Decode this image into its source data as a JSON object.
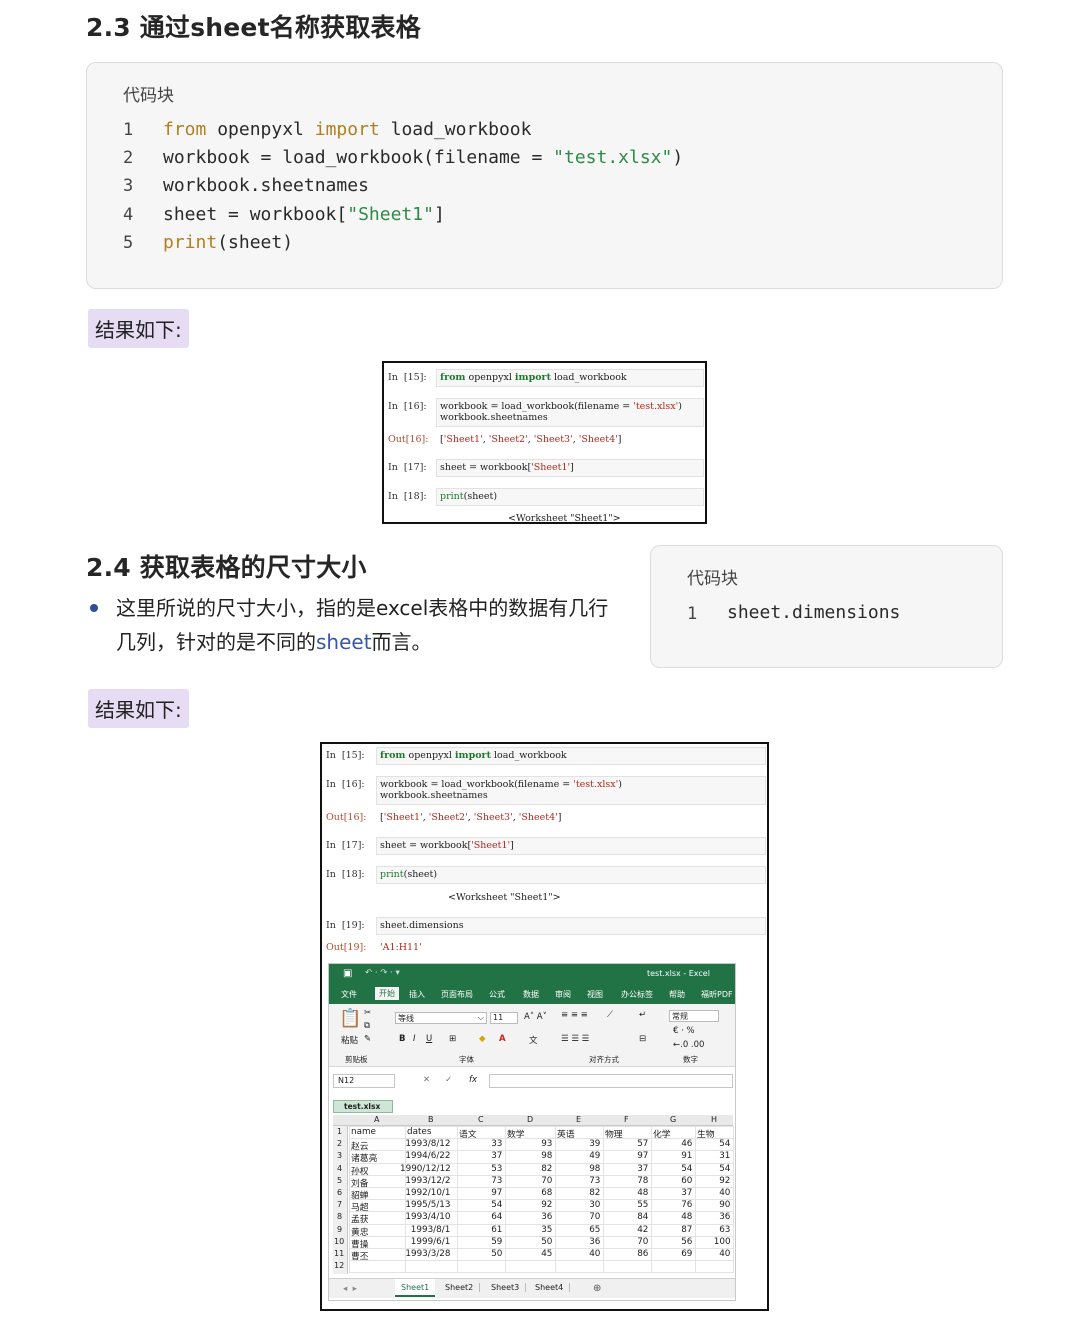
{
  "section1": {
    "title": "2.3 通过sheet名称获取表格",
    "code_caption": "代码块",
    "code_lines": [
      {
        "n": "1",
        "parts": [
          {
            "t": "from",
            "c": "kw"
          },
          {
            "t": " openpyxl ",
            "c": ""
          },
          {
            "t": "import",
            "c": "kw"
          },
          {
            "t": " load_workbook",
            "c": ""
          }
        ]
      },
      {
        "n": "2",
        "parts": [
          {
            "t": "workbook = load_workbook(filename = ",
            "c": ""
          },
          {
            "t": "\"test.xlsx\"",
            "c": "st"
          },
          {
            "t": ")",
            "c": ""
          }
        ]
      },
      {
        "n": "3",
        "parts": [
          {
            "t": "workbook.sheetnames",
            "c": ""
          }
        ]
      },
      {
        "n": "4",
        "parts": [
          {
            "t": "sheet = workbook[",
            "c": ""
          },
          {
            "t": "\"Sheet1\"",
            "c": "st"
          },
          {
            "t": "]",
            "c": ""
          }
        ]
      },
      {
        "n": "5",
        "parts": [
          {
            "t": "print",
            "c": "kw"
          },
          {
            "t": "(sheet)",
            "c": ""
          }
        ]
      }
    ],
    "result_label": "结果如下:"
  },
  "jupyter1": {
    "cells": [
      {
        "prompt": "In  [15]:",
        "code": "from openpyxl import load_workbook"
      },
      {
        "prompt": "In  [16]:",
        "code": "workbook = load_workbook(filename = 'test.xlsx')\nworkbook.sheetnames"
      },
      {
        "prompt": "Out[16]:",
        "code": "['Sheet1', 'Sheet2', 'Sheet3', 'Sheet4']"
      },
      {
        "prompt": "In  [17]:",
        "code": "sheet = workbook['Sheet1']"
      },
      {
        "prompt": "In  [18]:",
        "code": "print(sheet)"
      },
      {
        "prompt": "",
        "code": "<Worksheet \"Sheet1\">"
      }
    ]
  },
  "section2": {
    "title": "2.4 获取表格的尺寸大小",
    "para_line1": "这里所说的尺寸大小，指的是excel表格中的数据有几行",
    "para_line2_a": "几列，针对的是不同的",
    "para_line2_b": "sheet",
    "para_line2_c": "而言。",
    "code_caption": "代码块",
    "code_line_no": "1",
    "code_line": "sheet.dimensions",
    "result_label": "结果如下:"
  },
  "jupyter2": {
    "cells": [
      {
        "prompt": "In  [15]:",
        "code": "from openpyxl import load_workbook"
      },
      {
        "prompt": "In  [16]:",
        "code": "workbook = load_workbook(filename = 'test.xlsx')\nworkbook.sheetnames"
      },
      {
        "prompt": "Out[16]:",
        "code": "['Sheet1', 'Sheet2', 'Sheet3', 'Sheet4']"
      },
      {
        "prompt": "In  [17]:",
        "code": "sheet = workbook['Sheet1']"
      },
      {
        "prompt": "In  [18]:",
        "code": "print(sheet)"
      },
      {
        "prompt": "",
        "code": "<Worksheet \"Sheet1\">"
      },
      {
        "prompt": "In  [19]:",
        "code": "sheet.dimensions"
      },
      {
        "prompt": "Out[19]:",
        "code": "'A1:H11'"
      }
    ]
  },
  "excel": {
    "title": "test.xlsx - Excel",
    "ribbon_tabs": [
      "文件",
      "开始",
      "插入",
      "页面布局",
      "公式",
      "数据",
      "审阅",
      "视图",
      "办公标签",
      "帮助",
      "福昕PDF"
    ],
    "font_name": "等线",
    "font_size": "11",
    "number_format": "常规",
    "groups": [
      "剪贴板",
      "字体",
      "对齐方式",
      "数字"
    ],
    "paste_label": "粘贴",
    "name_box": "N12",
    "file_tab": "test.xlsx",
    "col_letters": [
      "A",
      "B",
      "C",
      "D",
      "E",
      "F",
      "G",
      "H"
    ],
    "headers": [
      "name",
      "dates",
      "语文",
      "数学",
      "英语",
      "物理",
      "化学",
      "生物"
    ],
    "rows": [
      [
        "赵云",
        "1993/8/12",
        "33",
        "93",
        "39",
        "57",
        "46",
        "54"
      ],
      [
        "诸葛亮",
        "1994/6/22",
        "37",
        "98",
        "49",
        "97",
        "91",
        "31"
      ],
      [
        "孙权",
        "1990/12/12",
        "53",
        "82",
        "98",
        "37",
        "54",
        "54"
      ],
      [
        "刘备",
        "1993/12/2",
        "73",
        "70",
        "73",
        "78",
        "60",
        "92"
      ],
      [
        "貂蝉",
        "1992/10/1",
        "97",
        "68",
        "82",
        "48",
        "37",
        "40"
      ],
      [
        "马超",
        "1995/5/13",
        "54",
        "92",
        "30",
        "55",
        "76",
        "90"
      ],
      [
        "孟获",
        "1993/4/10",
        "64",
        "36",
        "70",
        "84",
        "48",
        "36"
      ],
      [
        "黄忠",
        "1993/8/1",
        "61",
        "35",
        "65",
        "42",
        "87",
        "63"
      ],
      [
        "曹操",
        "1999/6/1",
        "59",
        "50",
        "36",
        "70",
        "56",
        "100"
      ],
      [
        "曹丕",
        "1993/3/28",
        "50",
        "45",
        "40",
        "86",
        "69",
        "40"
      ]
    ],
    "row_numbers": [
      "1",
      "2",
      "3",
      "4",
      "5",
      "6",
      "7",
      "8",
      "9",
      "10",
      "11",
      "12"
    ],
    "sheet_tabs": [
      "Sheet1",
      "Sheet2",
      "Sheet3",
      "Sheet4"
    ],
    "colors": {
      "green": "#217346",
      "dark_green": "#185c37"
    }
  }
}
